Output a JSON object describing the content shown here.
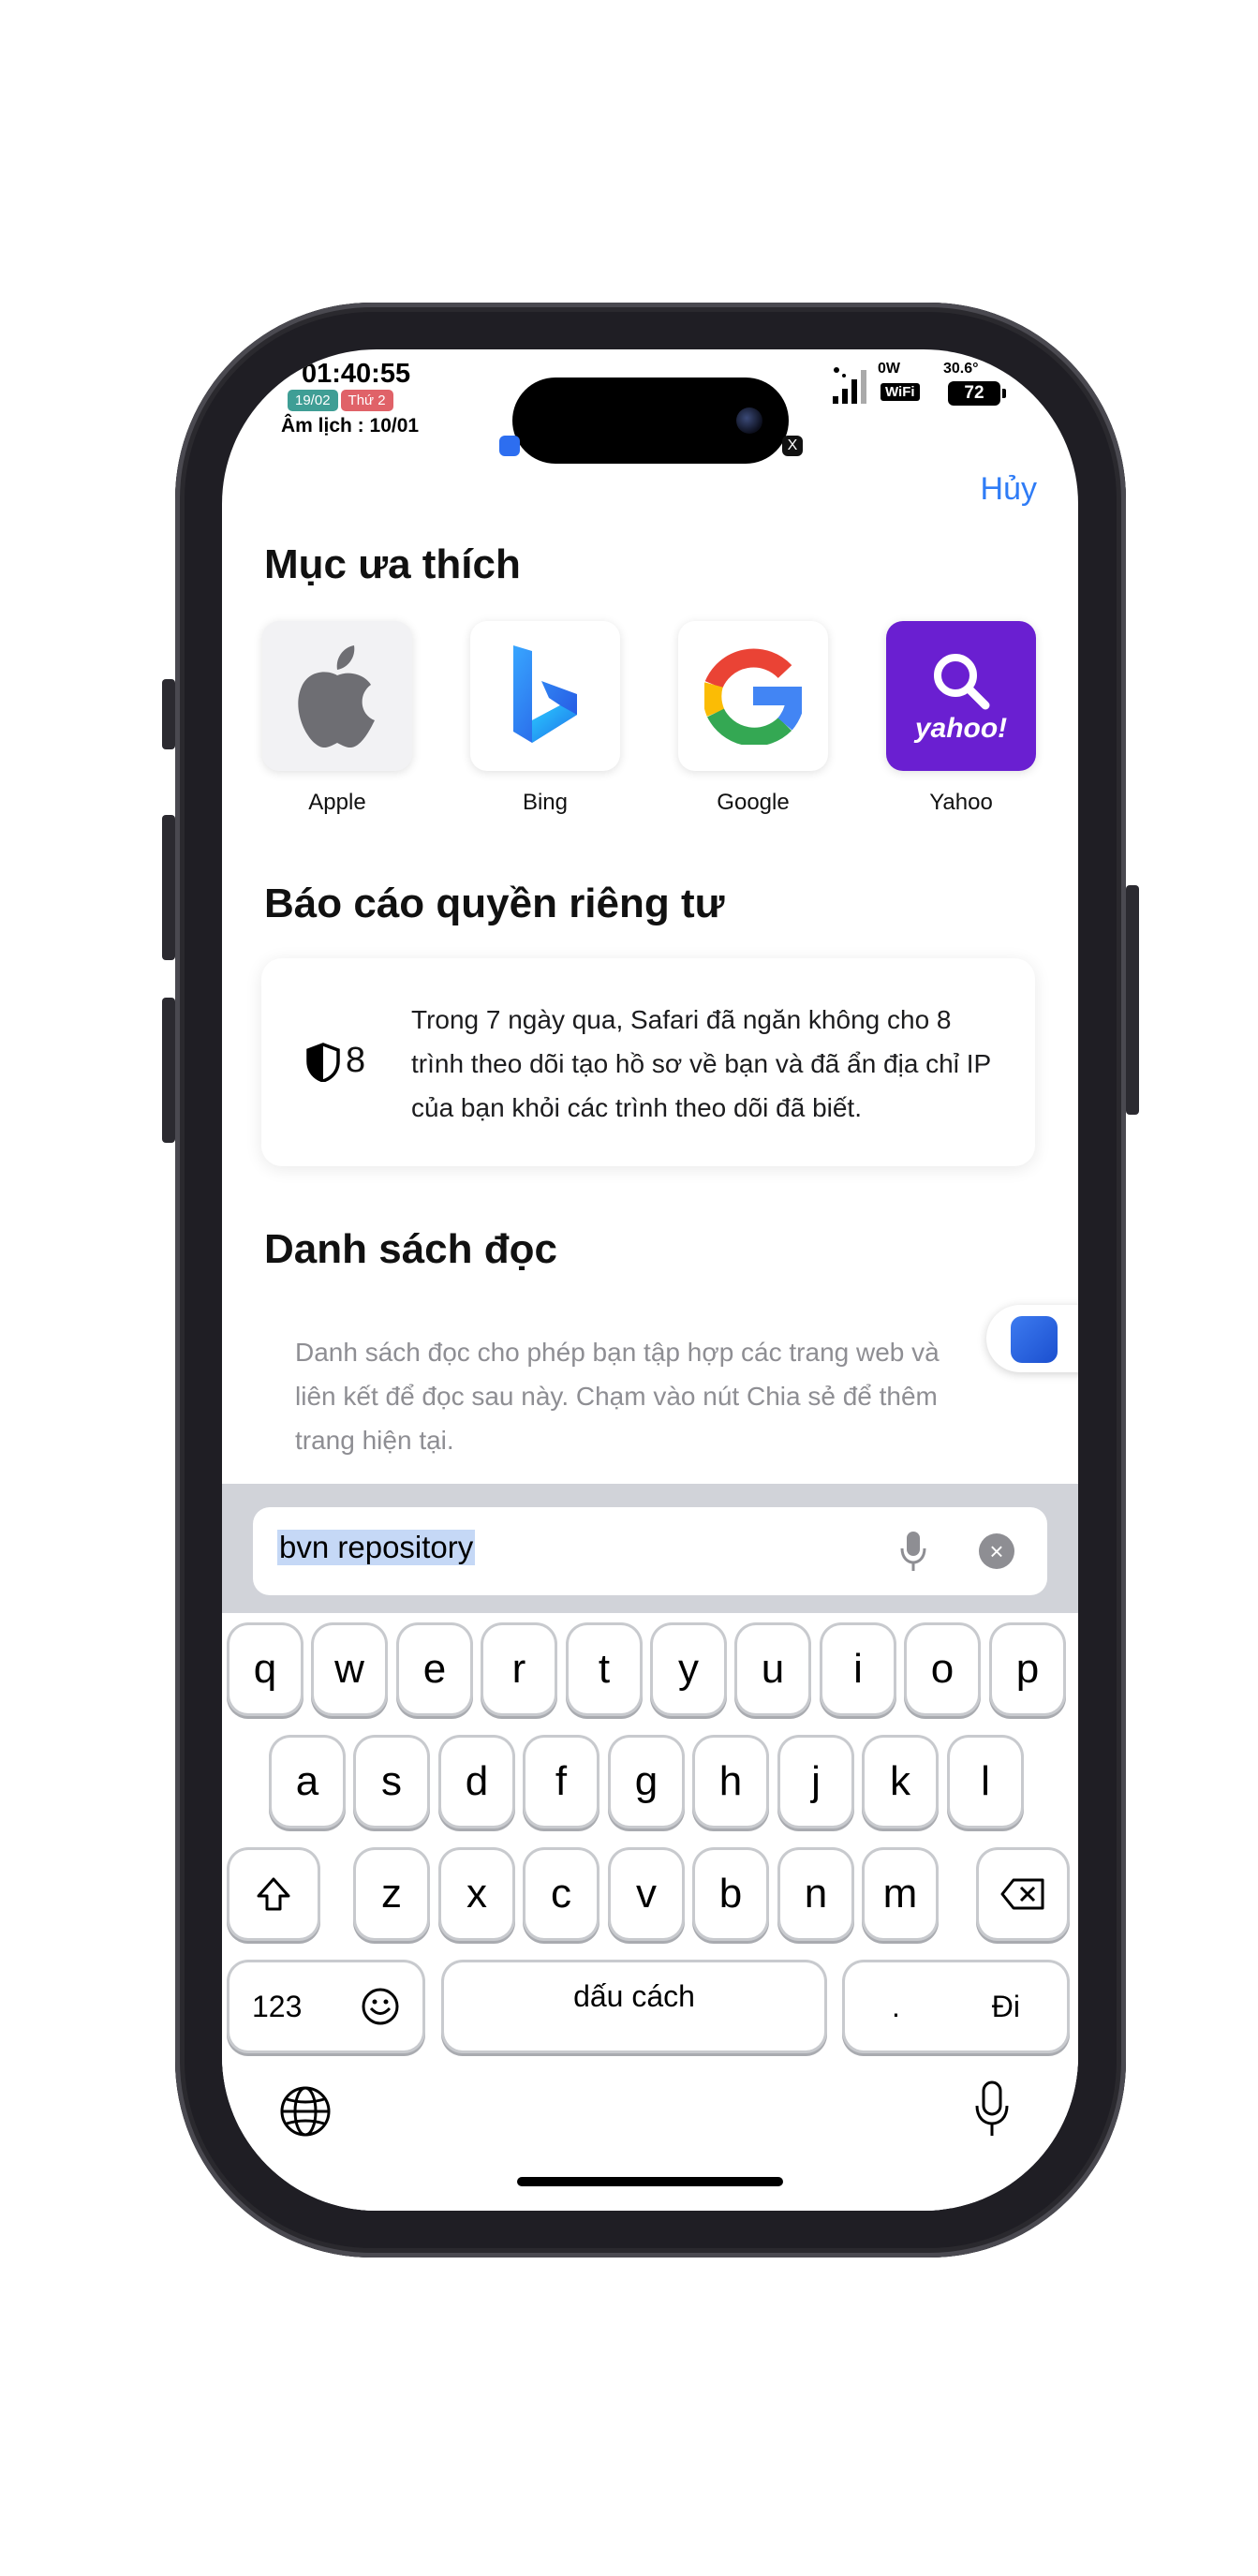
{
  "status_bar": {
    "time": "01:40:55",
    "date_badge": "19/02",
    "day_badge": "Thứ 2",
    "lunar": "Âm lịch : 10/01",
    "power": "0W",
    "temperature": "30.6°",
    "wifi_label": "WiFi",
    "battery": "72"
  },
  "header": {
    "cancel": "Hủy"
  },
  "favorites": {
    "title": "Mục ưa thích",
    "items": [
      {
        "label": "Apple",
        "icon": "apple-icon"
      },
      {
        "label": "Bing",
        "icon": "bing-icon"
      },
      {
        "label": "Google",
        "icon": "google-icon"
      },
      {
        "label": "Yahoo",
        "icon": "yahoo-icon",
        "logo_text": "yahoo!"
      }
    ]
  },
  "privacy": {
    "title": "Báo cáo quyền riêng tư",
    "count": "8",
    "text": "Trong 7 ngày qua, Safari đã ngăn không cho 8 trình theo dõi tạo hồ sơ về bạn và đã ẩn địa chỉ IP của bạn khỏi các trình theo dõi đã biết."
  },
  "reading_list": {
    "title": "Danh sách đọc",
    "text": "Danh sách đọc cho phép bạn tập hợp các trang web và liên kết để đọc sau này. Chạm vào nút Chia sẻ để thêm trang hiện tại."
  },
  "search": {
    "value": "bvn repository"
  },
  "keyboard": {
    "row1": [
      "q",
      "w",
      "e",
      "r",
      "t",
      "y",
      "u",
      "i",
      "o",
      "p"
    ],
    "row2": [
      "a",
      "s",
      "d",
      "f",
      "g",
      "h",
      "j",
      "k",
      "l"
    ],
    "row3": [
      "z",
      "x",
      "c",
      "v",
      "b",
      "n",
      "m"
    ],
    "numbers_key": "123",
    "space_key": "dấu cách",
    "period_key": ".",
    "go_key": "Đi"
  },
  "colors": {
    "accent": "#2f7cf6",
    "yahoo": "#6a1fd1"
  }
}
